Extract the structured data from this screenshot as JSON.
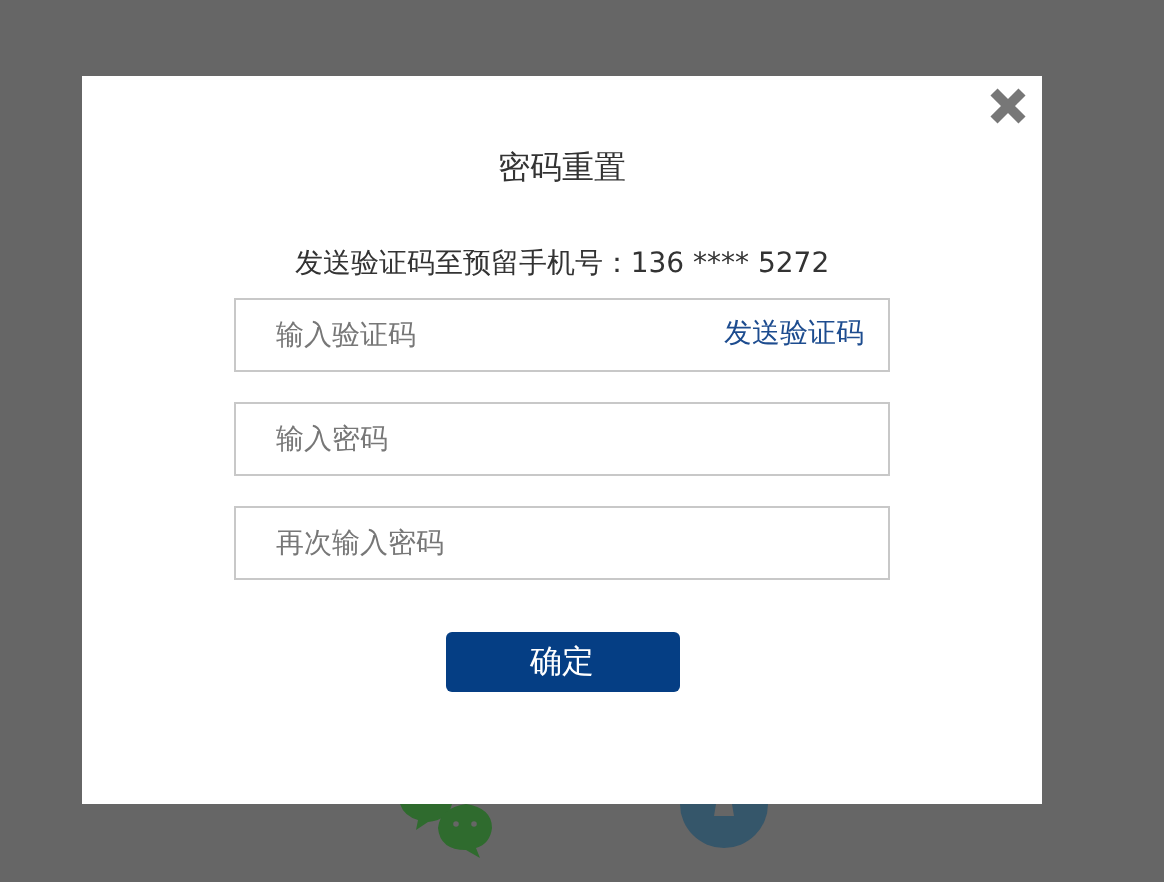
{
  "dialog": {
    "title": "密码重置",
    "message": "发送验证码至预留手机号：136 **** 5272",
    "fields": [
      {
        "placeholder": "输入验证码",
        "action": "发送验证码"
      },
      {
        "placeholder": "输入密码"
      },
      {
        "placeholder": "再次输入密码"
      }
    ],
    "confirm_button": "确定"
  }
}
